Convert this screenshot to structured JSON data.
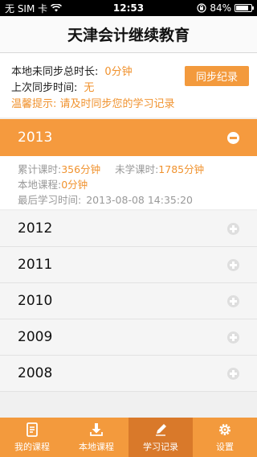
{
  "status_bar": {
    "carrier": "无 SIM 卡",
    "time": "12:53",
    "battery_percent": "84%",
    "battery_level": 0.84
  },
  "header": {
    "title": "天津会计继续教育"
  },
  "sync": {
    "unsynced_label": "本地未同步总时长:",
    "unsynced_value": "0分钟",
    "last_sync_label": "上次同步时间:",
    "last_sync_value": "无",
    "tip": "温馨提示: 请及时同步您的学习记录",
    "sync_button": "同步纪录"
  },
  "expanded_year": {
    "year": "2013",
    "studied_label": "累计课时:",
    "studied_value": "356分钟",
    "remaining_label": "未学课时:",
    "remaining_value": "1785分钟",
    "local_label": "本地课程:",
    "local_value": "0分钟",
    "last_study_label": "最后学习时间:",
    "last_study_value": "2013-08-08 14:35:20"
  },
  "years": [
    {
      "year": "2012"
    },
    {
      "year": "2011"
    },
    {
      "year": "2010"
    },
    {
      "year": "2009"
    },
    {
      "year": "2008"
    }
  ],
  "tabs": [
    {
      "label": "我的课程",
      "icon": "document-icon",
      "active": false
    },
    {
      "label": "本地课程",
      "icon": "download-icon",
      "active": false
    },
    {
      "label": "学习记录",
      "icon": "pencil-icon",
      "active": true
    },
    {
      "label": "设置",
      "icon": "gear-icon",
      "active": false
    }
  ],
  "colors": {
    "accent": "#f39a3d",
    "accent_dark": "#d9792a",
    "highlight_text": "#f0922e"
  }
}
